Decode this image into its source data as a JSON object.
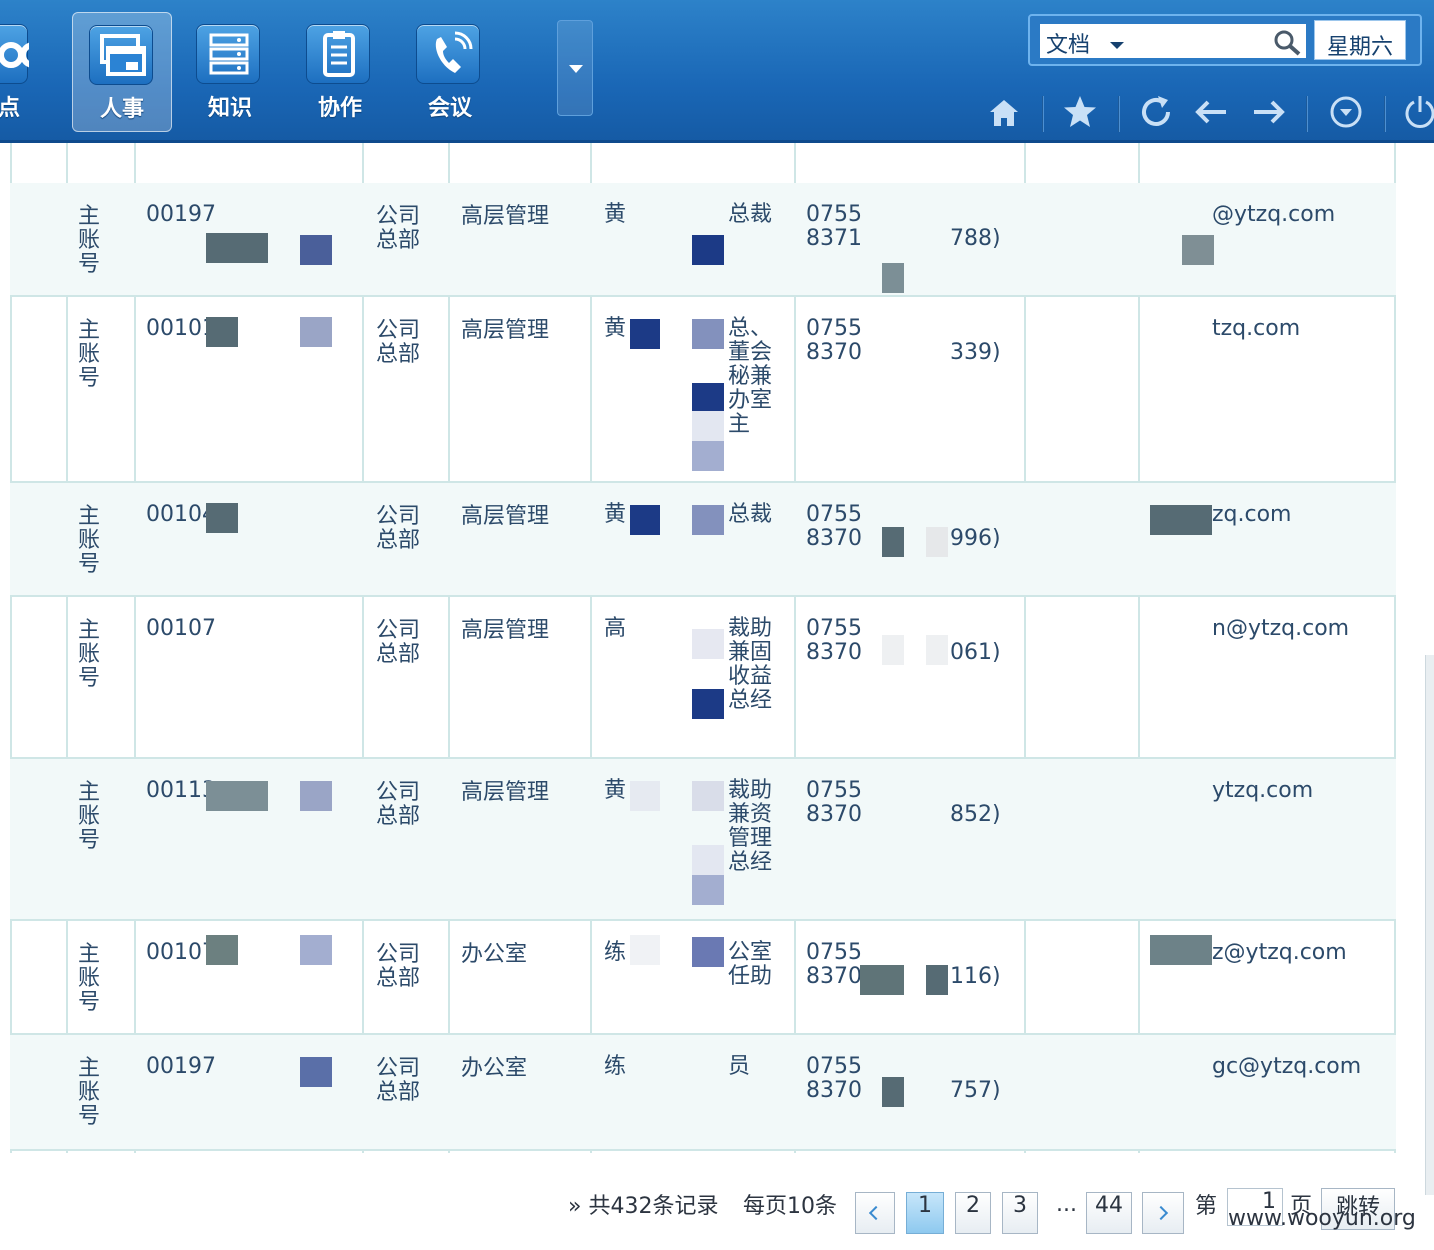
{
  "nav": {
    "items": [
      {
        "label": "单点",
        "icon": "link-icon"
      },
      {
        "label": "人事",
        "icon": "window-icon",
        "active": true
      },
      {
        "label": "知识",
        "icon": "server-icon"
      },
      {
        "label": "协作",
        "icon": "clipboard-icon"
      },
      {
        "label": "会议",
        "icon": "phone-icon"
      }
    ]
  },
  "search": {
    "category": "文档",
    "weekday": "星期六"
  },
  "toolbar": [
    "home-icon",
    "star-icon",
    "refresh-icon",
    "back-arrow-icon",
    "forward-arrow-icon",
    "down-circle-icon",
    "power-icon"
  ],
  "table": {
    "rows": [
      {
        "type": "主账号",
        "id": "00197",
        "dept": "公司总部",
        "group": "高层管理",
        "name": "黄",
        "title": "总裁",
        "phone1": "0755",
        "phone2": "8371",
        "ext": "788)",
        "email": "@ytzq.com"
      },
      {
        "type": "主账号",
        "id": "00101",
        "dept": "公司总部",
        "group": "高层管理",
        "name": "黄",
        "title": "总、董会秘兼办室主",
        "phone1": "0755",
        "phone2": "8370",
        "ext": "339)",
        "email": "tzq.com"
      },
      {
        "type": "主账号",
        "id": "00104",
        "dept": "公司总部",
        "group": "高层管理",
        "name": "黄",
        "title": "总裁",
        "phone1": "0755",
        "phone2": "8370",
        "ext": "996)",
        "email": "zq.com"
      },
      {
        "type": "主账号",
        "id": "00107",
        "dept": "公司总部",
        "group": "高层管理",
        "name": "高",
        "title": "裁助兼固收益总经",
        "phone1": "0755",
        "phone2": "8370",
        "ext": "061)",
        "email": "n@ytzq.com"
      },
      {
        "type": "主账号",
        "id": "00113",
        "dept": "公司总部",
        "group": "高层管理",
        "name": "黄",
        "title": "裁助兼资管理总经",
        "phone1": "0755",
        "phone2": "8370",
        "ext": "852)",
        "email": "ytzq.com"
      },
      {
        "type": "主账号",
        "id": "00107",
        "dept": "公司总部",
        "group": "办公室",
        "name": "练",
        "title": "公室任助",
        "phone1": "0755",
        "phone2": "8370",
        "ext": "116)",
        "email": "z@ytzq.com"
      },
      {
        "type": "主账号",
        "id": "00197",
        "dept": "公司总部",
        "group": "办公室",
        "name": "练",
        "title": "员",
        "phone1": "0755",
        "phone2": "8370",
        "ext": "757)",
        "email": "gc@ytzq.com"
      }
    ]
  },
  "pager": {
    "summary": "» 共432条记录",
    "per_page": "每页10条",
    "pages": [
      "1",
      "2",
      "3",
      "...",
      "44"
    ],
    "current": "1",
    "goto_prefix": "第",
    "goto_value": "1",
    "goto_suffix": "页",
    "jump_label": "跳转"
  },
  "watermark": "www.wooyun.org"
}
